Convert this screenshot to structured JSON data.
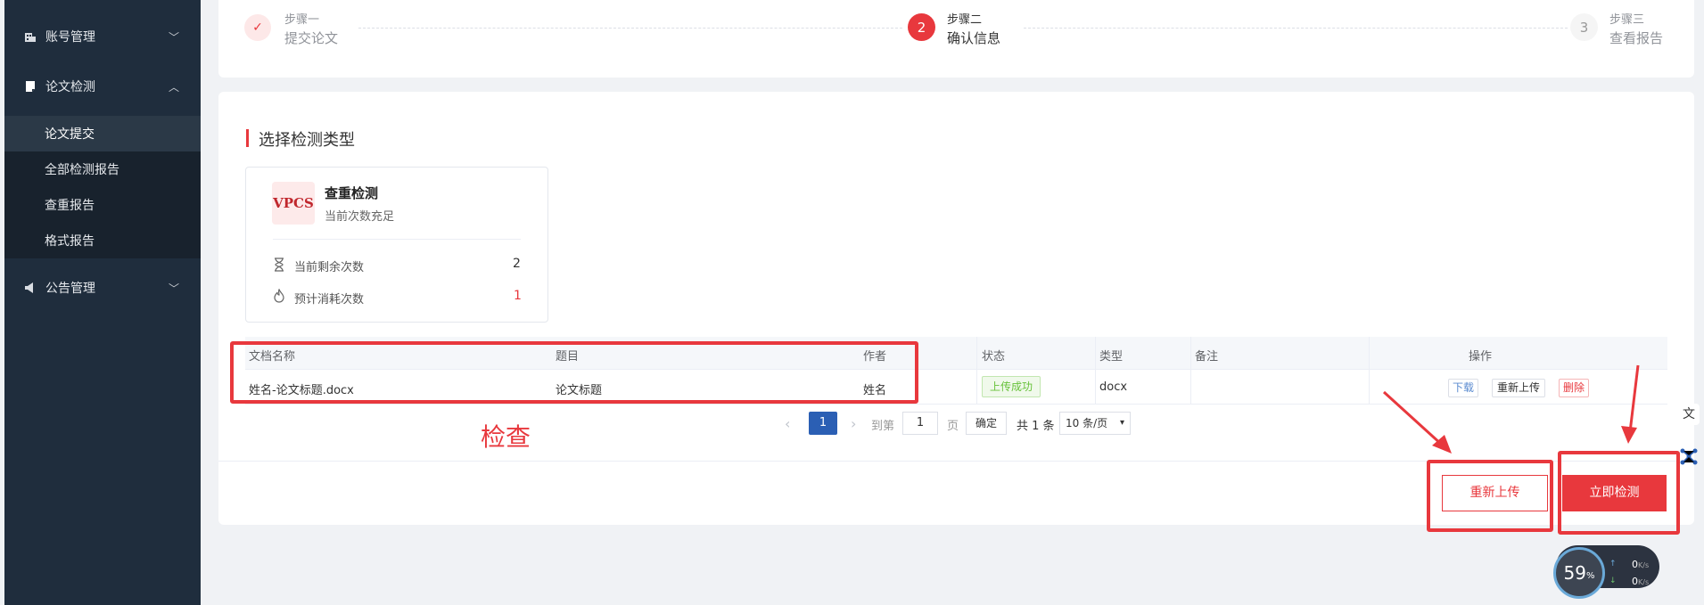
{
  "sidebar": {
    "items": [
      {
        "label": "账号管理",
        "icon": "building-icon",
        "expanded": false
      },
      {
        "label": "论文检测",
        "icon": "document-icon",
        "expanded": true
      },
      {
        "label": "公告管理",
        "icon": "megaphone-icon",
        "expanded": false
      }
    ],
    "sub_items": [
      {
        "label": "论文提交",
        "active": true
      },
      {
        "label": "全部检测报告",
        "active": false
      },
      {
        "label": "查重报告",
        "active": false
      },
      {
        "label": "格式报告",
        "active": false
      }
    ]
  },
  "steps": [
    {
      "index": "✓",
      "title": "步骤一",
      "desc": "提交论文",
      "state": "done"
    },
    {
      "index": "2",
      "title": "步骤二",
      "desc": "确认信息",
      "state": "active"
    },
    {
      "index": "3",
      "title": "步骤三",
      "desc": "查看报告",
      "state": "pending"
    }
  ],
  "main": {
    "section_title": "选择检测类型",
    "detect_card": {
      "logo_text": "VPCS",
      "title": "查重检测",
      "subtitle": "当前次数充足",
      "remaining_label": "当前剩余次数",
      "remaining_value": "2",
      "cost_label": "预计消耗次数",
      "cost_value": "1"
    },
    "table": {
      "headers": [
        "文档名称",
        "题目",
        "作者",
        "状态",
        "类型",
        "备注",
        "操作"
      ],
      "rows": [
        {
          "filename": "姓名-论文标题.docx",
          "title": "论文标题",
          "author": "姓名",
          "status": "上传成功",
          "type": "docx",
          "note": "",
          "actions": {
            "download": "下载",
            "reupload": "重新上传",
            "delete": "删除"
          }
        }
      ]
    },
    "pagination": {
      "current_page": "1",
      "goto_label": "到第",
      "goto_value": "1",
      "page_unit": "页",
      "confirm": "确定",
      "total": "共 1 条",
      "page_size": "10 条/页"
    },
    "annotation_text": "检查",
    "buttons": {
      "reupload": "重新上传",
      "detect_now": "立即检测"
    }
  },
  "widget": {
    "percent": "59",
    "percent_unit": "%",
    "up_value": "0",
    "down_value": "0",
    "rate_unit": "K/s"
  },
  "colors": {
    "accent": "#e8383d",
    "sidebar_bg": "#1f2d3d",
    "primary": "#2b5fb4",
    "success": "#67c23a"
  }
}
